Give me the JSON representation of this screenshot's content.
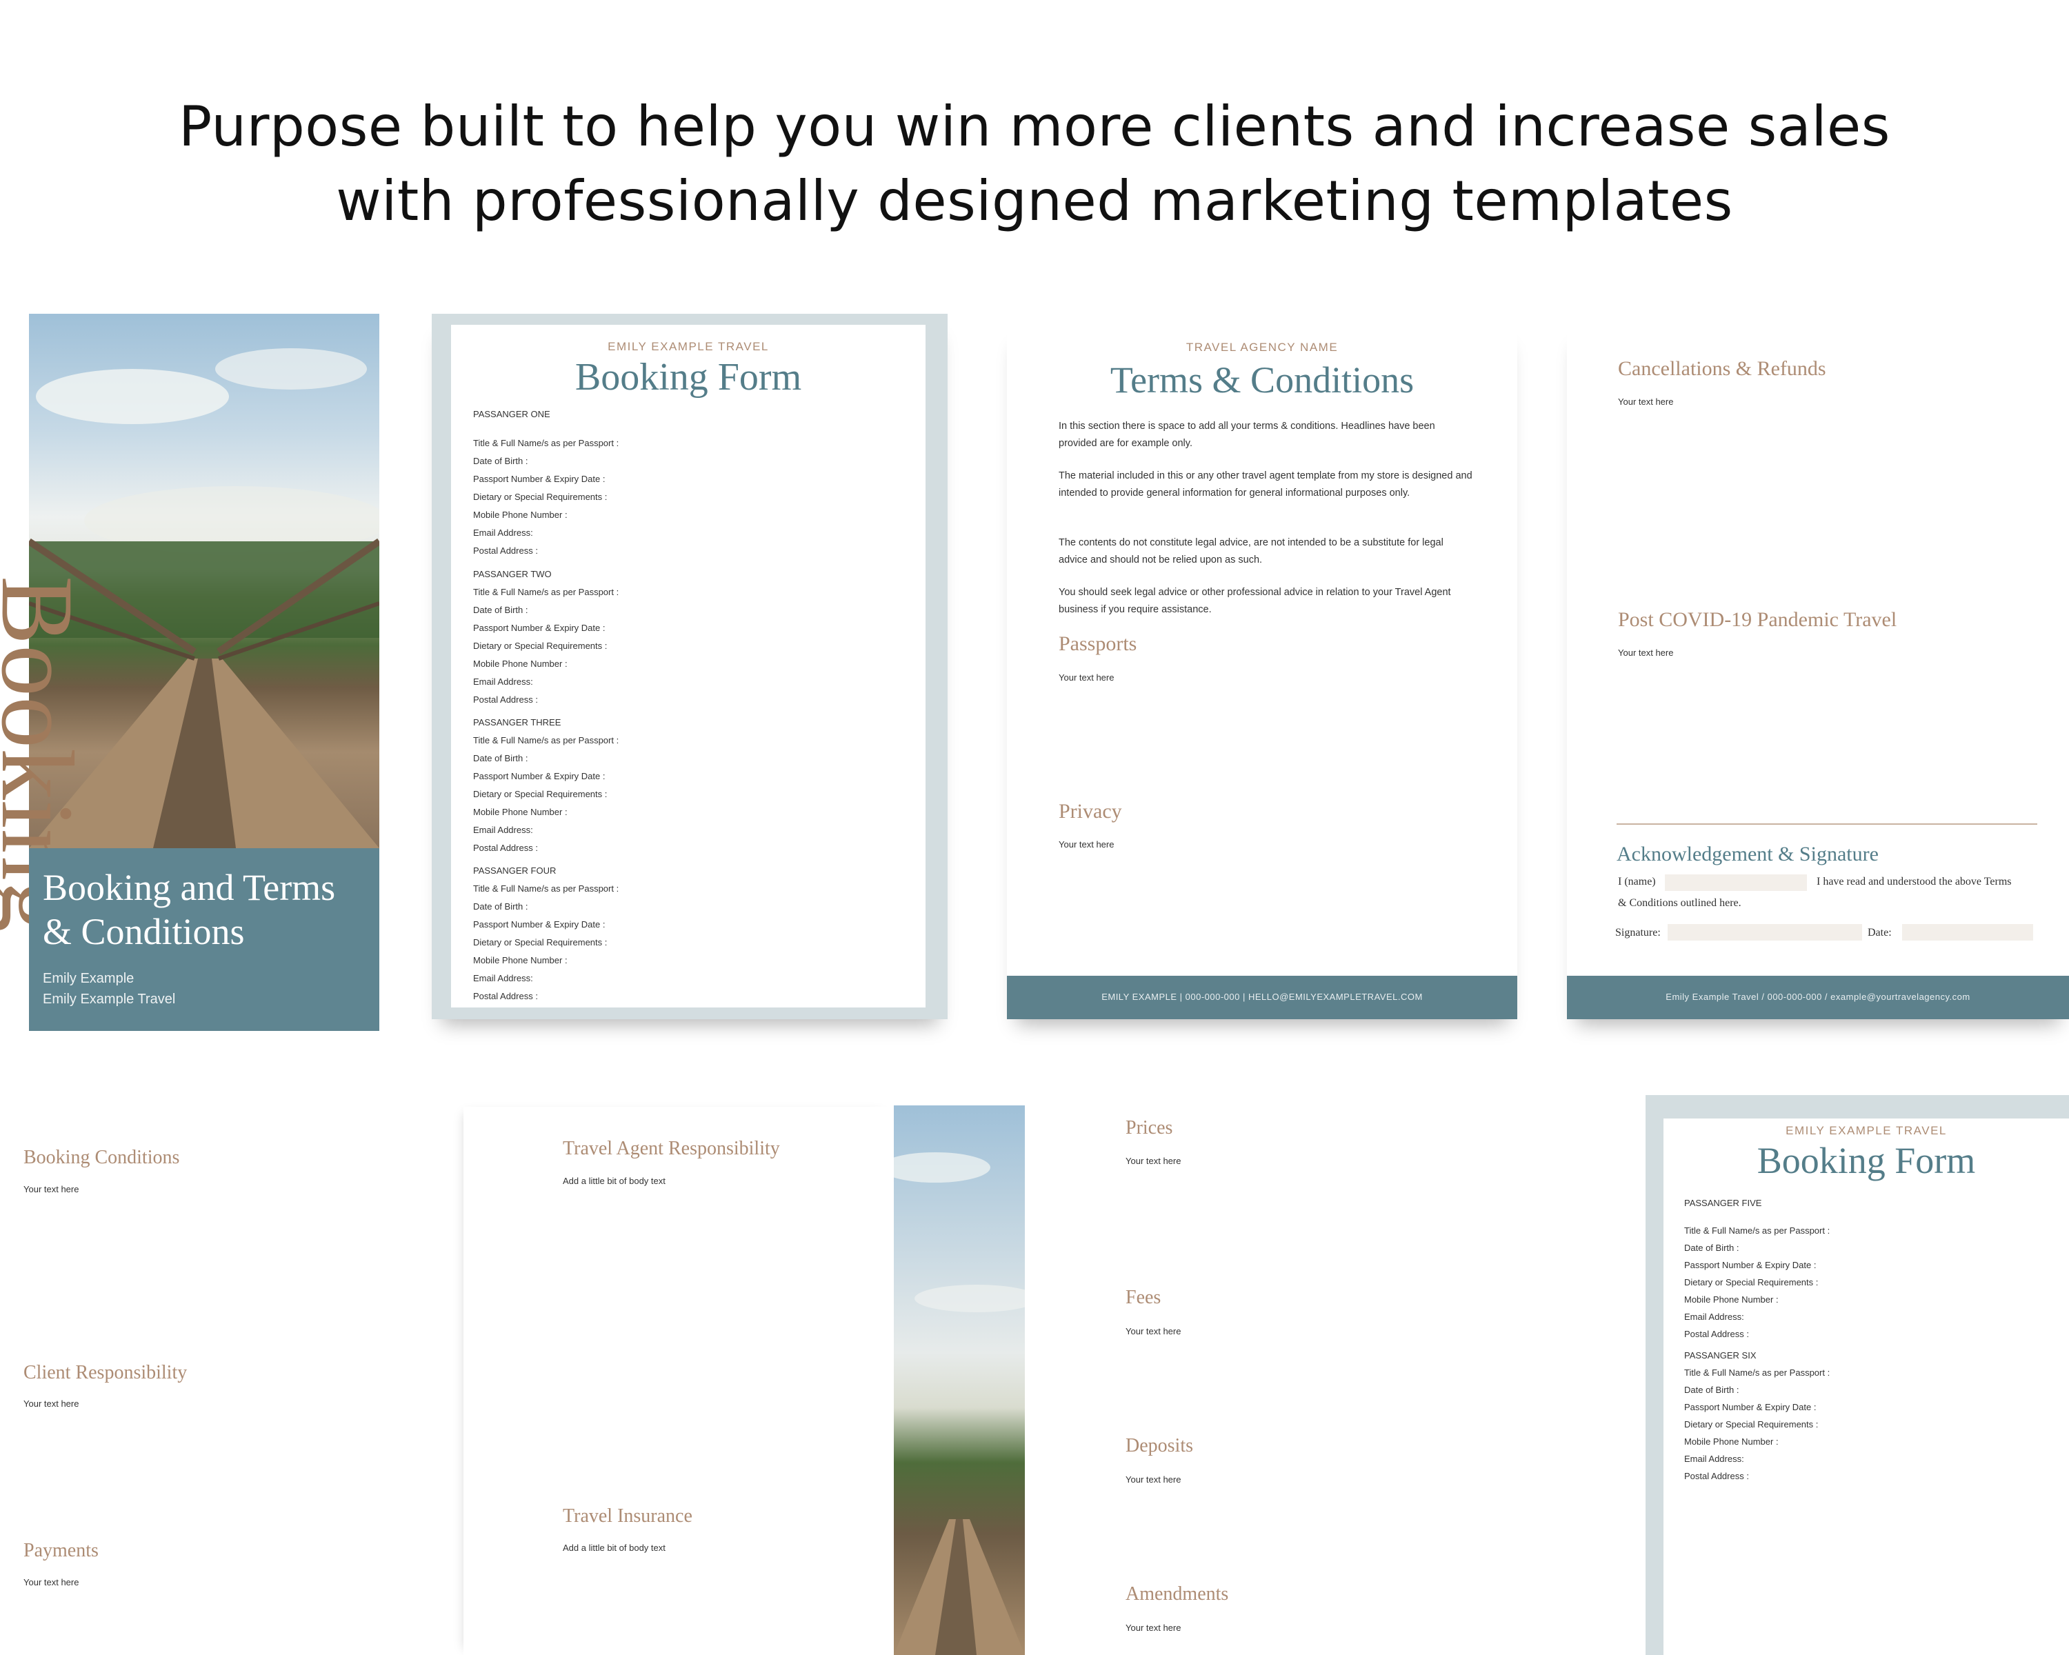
{
  "headline": {
    "line1": "Purpose built to help you win more clients and increase sales",
    "line2": "with professionally designed marketing templates"
  },
  "colors": {
    "teal": "#5d818c",
    "tan": "#ad8c74",
    "frame": "#d3dde0"
  },
  "cover": {
    "side_word": "Booking",
    "title_line1": "Booking and Terms",
    "title_line2": "& Conditions",
    "name": "Emily Example",
    "company": "Emily Example Travel"
  },
  "booking1": {
    "agency": "EMILY EXAMPLE TRAVEL",
    "title": "Booking Form",
    "passengers": [
      {
        "heading": "PASSANGER ONE"
      },
      {
        "heading": "PASSANGER TWO"
      },
      {
        "heading": "PASSANGER THREE"
      },
      {
        "heading": "PASSANGER FOUR"
      }
    ],
    "fields": [
      "Title & Full Name/s as per Passport :",
      "Date of Birth :",
      "Passport Number & Expiry Date :",
      "Dietary or Special Requirements :",
      "Mobile Phone Number :",
      "Email Address:",
      "Postal Address :"
    ]
  },
  "terms": {
    "agency": "TRAVEL AGENCY NAME",
    "title": "Terms & Conditions",
    "p1": "In this section there is space to add all your terms & conditions. Headlines have been provided are for example only.",
    "p2": "The material included in this or any other travel agent template from my store is designed and intended to provide general information for general informational purposes only.",
    "p3": "The contents do not constitute legal advice, are not intended to be a substitute for legal advice and should not be relied upon as such.",
    "p4": "You should seek legal advice or other professional advice in relation to your Travel Agent business if you require assistance.",
    "h_passports": "Passports",
    "t_passports": "Your text here",
    "h_privacy": "Privacy",
    "t_privacy": "Your text here",
    "footer": "EMILY   EXAMPLE   |   000-000-000   |   HELLO@EMILYEXAMPLETRAVEL.COM"
  },
  "cancel": {
    "h_cancel": "Cancellations & Refunds",
    "t_cancel": "Your text here",
    "h_covid": "Post COVID-19 Pandemic Travel",
    "t_covid": "Your text here",
    "h_ack": "Acknowledgement & Signature",
    "i_name": "I (name)",
    "read_text1": "I have read and understood the above Terms",
    "read_text2": "& Conditions outlined here.",
    "signature": "Signature:",
    "date": "Date:",
    "footer": "Emily Example Travel   /   000-000-000   /   example@yourtravelagency.com"
  },
  "conditions": {
    "h1": "Booking Conditions",
    "t1": "Your text here",
    "h2": "Client Responsibility",
    "t2": "Your text here",
    "h3": "Payments",
    "t3": "Your text here"
  },
  "agent": {
    "h1": "Travel Agent Responsibility",
    "t1": "Add a little bit of body text",
    "h2": "Travel Insurance",
    "t2": "Add a little bit of body text"
  },
  "prices": {
    "h1": "Prices",
    "t1": "Your text here",
    "h2": "Fees",
    "t2": "Your text here",
    "h3": "Deposits",
    "t3": "Your text here",
    "h4": "Amendments",
    "t4": "Your text here"
  },
  "booking2": {
    "agency": "EMILY EXAMPLE TRAVEL",
    "title": "Booking Form",
    "passengers": [
      {
        "heading": "PASSANGER FIVE"
      },
      {
        "heading": "PASSANGER SIX"
      }
    ],
    "fields": [
      "Title & Full Name/s as per Passport :",
      "Date of Birth :",
      "Passport Number & Expiry Date :",
      "Dietary or Special Requirements :",
      "Mobile Phone Number :",
      "Email Address:",
      "Postal Address :"
    ]
  }
}
